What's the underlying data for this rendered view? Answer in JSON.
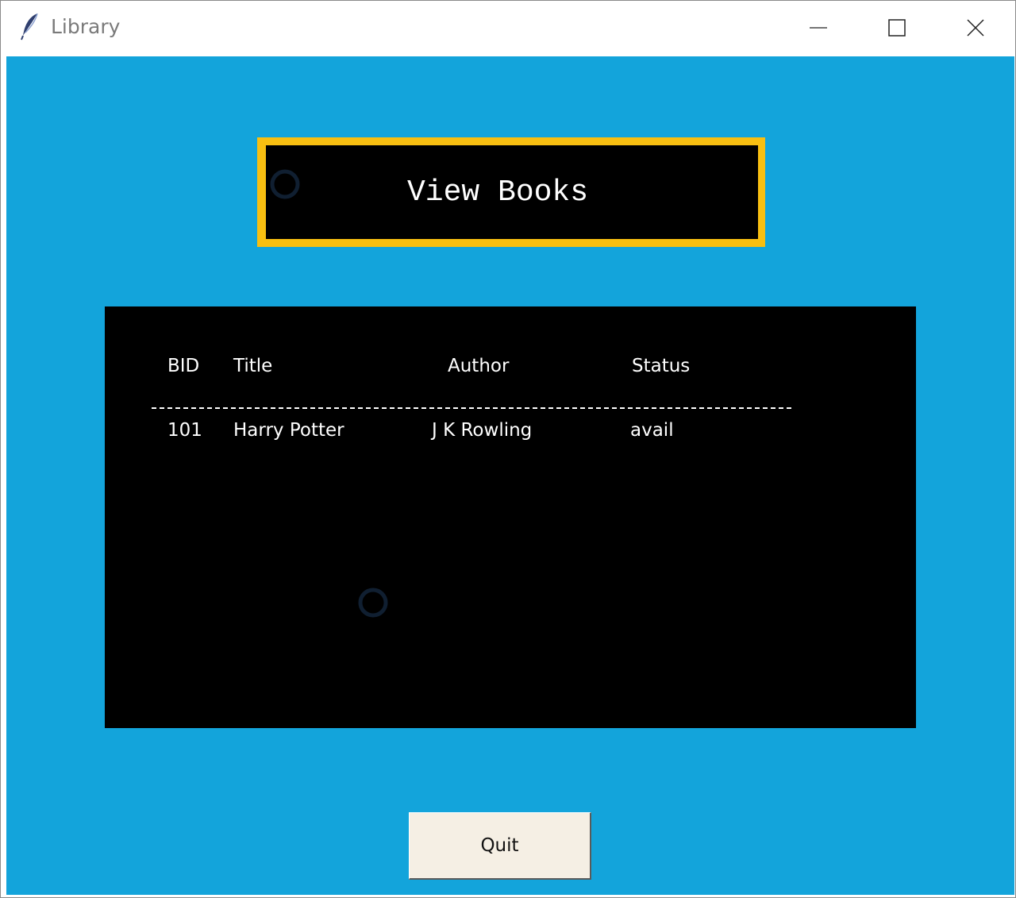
{
  "window": {
    "title": "Library",
    "icon": "feather-icon"
  },
  "heading": {
    "text": "View Books"
  },
  "table": {
    "columns": [
      "BID",
      "Title",
      "Author",
      "Status"
    ],
    "divider": "--------------------------------------------------------------------------------",
    "rows": [
      [
        "101",
        "Harry Potter",
        "J K Rowling",
        "avail"
      ]
    ]
  },
  "quit": {
    "label": "Quit"
  },
  "colors": {
    "background": "#13a4db",
    "heading_border": "#f8bf11",
    "panel": "#000000",
    "button": "#f5efe4"
  }
}
